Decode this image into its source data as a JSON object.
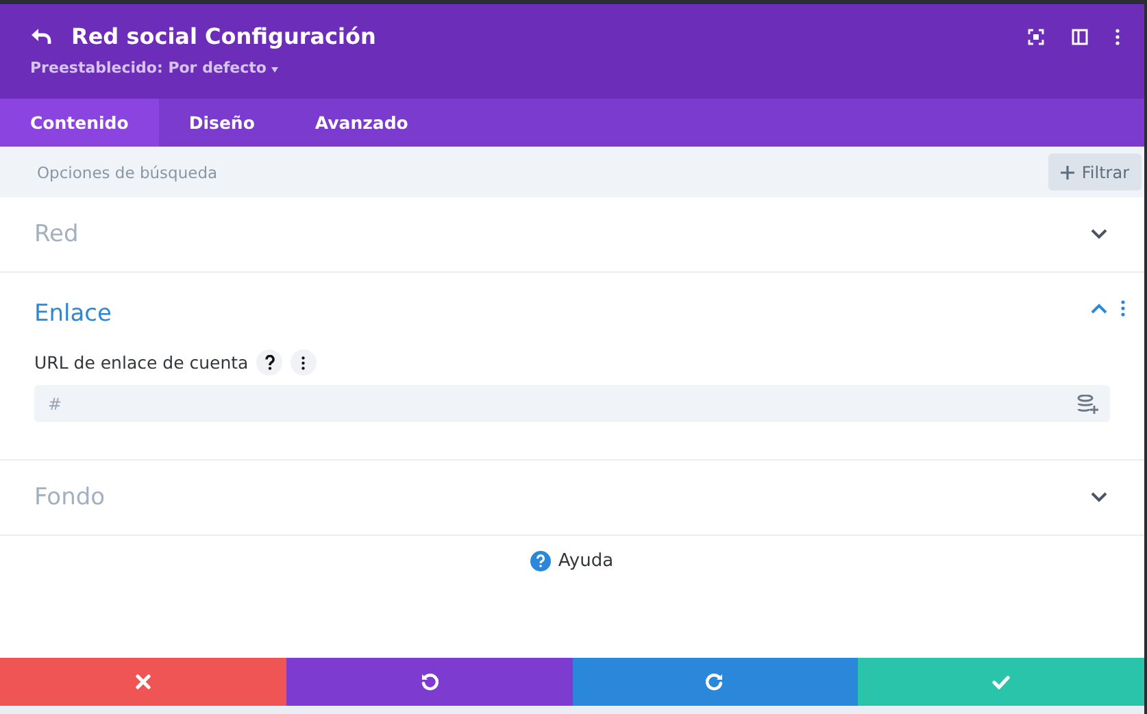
{
  "header": {
    "title": "Red social Configuración",
    "preset": "Preestablecido: Por defecto"
  },
  "tabs": [
    {
      "label": "Contenido",
      "selected": true
    },
    {
      "label": "Diseño",
      "selected": false
    },
    {
      "label": "Avanzado",
      "selected": false
    }
  ],
  "search": {
    "placeholder": "Opciones de búsqueda",
    "filter_label": "Filtrar"
  },
  "sections": [
    {
      "title": "Red",
      "expanded": false
    },
    {
      "title": "Enlace",
      "expanded": true,
      "fields": [
        {
          "label": "URL de enlace de cuenta",
          "placeholder": "#"
        }
      ]
    },
    {
      "title": "Fondo",
      "expanded": false
    }
  ],
  "help": {
    "label": "Ayuda"
  },
  "footer_buttons": [
    {
      "kind": "cancel"
    },
    {
      "kind": "undo"
    },
    {
      "kind": "redo"
    },
    {
      "kind": "save"
    }
  ]
}
